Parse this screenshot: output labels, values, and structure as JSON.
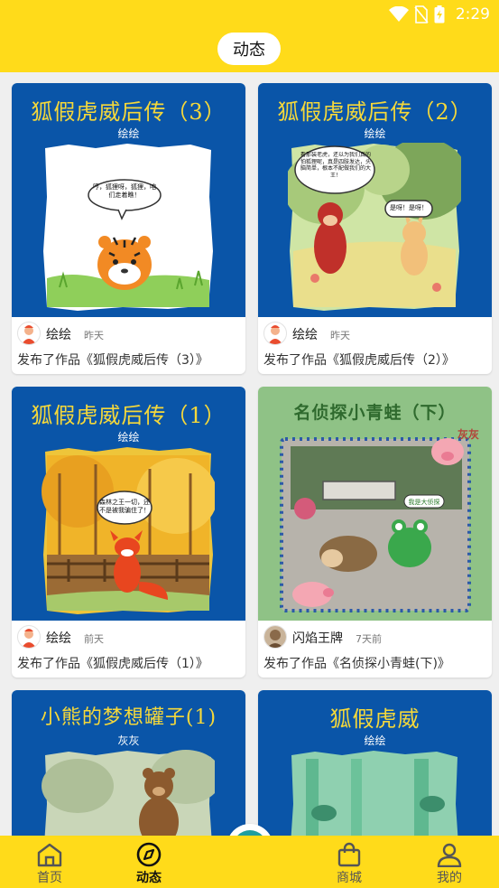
{
  "status_bar": {
    "time": "2:29"
  },
  "header": {
    "title": "动态"
  },
  "feed": [
    {
      "cover_title": "狐假虎威后传（3）",
      "cover_author": "绘绘",
      "bubble_text": "哼，狐狸呀，狐狸，咱们走着瞧！",
      "bubble_text_2": "",
      "author": "绘绘",
      "time": "昨天",
      "publish_text": "发布了作品《狐假虎威后传（3）》"
    },
    {
      "cover_title": "狐假虎威后传（2）",
      "cover_author": "绘绘",
      "bubble_text": "看那装老虎，还以为我们真的怕狐狸呢，真是四肢发达，头脑简单，根本不配做我们的大王！",
      "bubble_text_2": "是呀！是呀！",
      "author": "绘绘",
      "time": "昨天",
      "publish_text": "发布了作品《狐假虎威后传（2）》"
    },
    {
      "cover_title": "狐假虎威后传（1）",
      "cover_author": "绘绘",
      "bubble_text": "森林之王一切，还不是被我骗住了！",
      "bubble_text_2": "",
      "author": "绘绘",
      "time": "前天",
      "publish_text": "发布了作品《狐假虎威后传（1）》"
    },
    {
      "cover_title": "名侦探小青蛙（下）",
      "cover_author": "",
      "bubble_text": "我是大侦探",
      "bubble_text_2": "",
      "cover_tag": "灰灰",
      "author": "闪焰王牌",
      "time": "7天前",
      "publish_text": "发布了作品《名侦探小青蛙(下)》"
    },
    {
      "cover_title": "小熊的梦想罐子(1)",
      "cover_author": "灰灰"
    },
    {
      "cover_title": "狐假虎威",
      "cover_author": "绘绘"
    }
  ],
  "bottom_nav": {
    "items": [
      {
        "label": "首页",
        "icon": "home-icon"
      },
      {
        "label": "动态",
        "icon": "compass-icon"
      },
      {
        "label": "商城",
        "icon": "shopping-bag-icon"
      },
      {
        "label": "我的",
        "icon": "profile-icon"
      }
    ],
    "fab_icon": "plus-icon"
  },
  "colors": {
    "brand_yellow": "#ffdb1a",
    "cover_blue": "#0a55a8",
    "cover_title_yellow": "#f5d83a"
  }
}
